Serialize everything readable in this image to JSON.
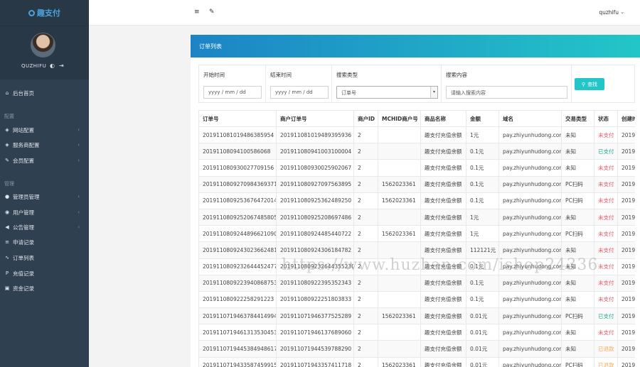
{
  "brand": {
    "title": "趣支付"
  },
  "profile": {
    "username": "QUZHIFU"
  },
  "sidebar": {
    "home": "后台首页",
    "section_config": "配置",
    "config_items": [
      "网站配置",
      "服务商配置",
      "会员配置"
    ],
    "section_manage": "管理",
    "manage_items": [
      "管理员管理",
      "用户管理",
      "公告管理",
      "申请记录",
      "订单列表",
      "充值记录",
      "资金记录"
    ]
  },
  "topbar": {
    "user": "quzhifu"
  },
  "card": {
    "title": "订单列表"
  },
  "search": {
    "start_label": "开始时间",
    "start_placeholder": "yyyy / mm / dd",
    "end_label": "结束时间",
    "end_placeholder": "yyyy / mm / dd",
    "type_label": "搜索类型",
    "type_value": "订单号",
    "content_label": "搜索内容",
    "content_placeholder": "请输入搜索内容",
    "button": "查找"
  },
  "table": {
    "headers": [
      "订单号",
      "商户订单号",
      "商户ID",
      "MCHID商户号",
      "商品名称",
      "金额",
      "域名",
      "交易类型",
      "状态",
      "创建时"
    ],
    "rows": [
      [
        "20191108101948638595​4",
        "2019110810194893​95936",
        "2",
        "",
        "趣支付充值余额",
        "1元",
        "pay.zhiyunhudong.com",
        "未知",
        "未支付",
        "2019-"
      ],
      [
        "20191108094100586068",
        "20191108094100310000​4",
        "2",
        "",
        "趣支付充值余额",
        "0.1元",
        "pay.zhiyunhudong.com",
        "未知",
        "已支付",
        "2019-"
      ],
      [
        "20191108093002770915​6",
        "20191108093002590206​7",
        "2",
        "",
        "趣支付充值余额",
        "0.1元",
        "pay.zhiyunhudong.com",
        "未知",
        "未支付",
        "2019"
      ],
      [
        "20191108092709843693​71",
        "20191108092709756389​5",
        "2",
        "1562023361",
        "趣支付充值余额",
        "0.1元",
        "pay.zhiyunhudong.com",
        "PC扫码",
        "未支付",
        "2019-"
      ],
      [
        "20191108092536764720​14",
        "20191108092536248925​0",
        "2",
        "1562023361",
        "趣支付充值余额",
        "0.1元",
        "pay.zhiyunhudong.com",
        "PC扫码",
        "未支付",
        "2019-"
      ],
      [
        "20191108092520674858​05",
        "20191108092520869748​6",
        "2",
        "",
        "趣支付充值余额",
        "1元",
        "pay.zhiyunhudong.com",
        "未知",
        "未支付",
        "2019-"
      ],
      [
        "20191108092448966210​90",
        "20191108092448544072​2",
        "2",
        "1562023361",
        "趣支付充值余额",
        "1元",
        "pay.zhiyunhudong.com",
        "PC扫码",
        "未支付",
        "2019-"
      ],
      [
        "20191108092430236624​81",
        "20191108092430618478​2",
        "2",
        "",
        "趣支付充值余额",
        "112121元",
        "pay.zhiyunhudong.com",
        "未知",
        "未支付",
        "2019-"
      ],
      [
        "20191108092326444524​77",
        "20191108092326443552​30",
        "2",
        "",
        "趣支付充值余额",
        "0.1元",
        "pay.zhiyunhudong.com",
        "未知",
        "未支付",
        "2019-"
      ],
      [
        "20191108092239408687​53",
        "20191108092239535234​3",
        "2",
        "",
        "趣支付充值余额",
        "0.1元",
        "pay.zhiyunhudong.com",
        "未知",
        "未支付",
        "2019-"
      ],
      [
        "20191108092225829122​3",
        "20191108092225180383​3",
        "2",
        "",
        "趣支付充值余额",
        "0.1元",
        "pay.zhiyunhudong.com",
        "未知",
        "未支付",
        "2019-"
      ],
      [
        "20191107194637844149​94",
        "20191107194637752528​9",
        "2",
        "1562023361",
        "趣支付充值余额",
        "0.01元",
        "pay.zhiyunhudong.com",
        "PC扫码",
        "已支付",
        "2019-"
      ],
      [
        "20191107194613135304​53",
        "20191107194613768906​0",
        "2",
        "",
        "趣支付充值余额",
        "0.01元",
        "pay.zhiyunhudong.com",
        "未知",
        "未支付",
        "2019-"
      ],
      [
        "20191107194453849486​17",
        "20191107194453978829​0",
        "2",
        "",
        "趣支付充值余额",
        "0.01元",
        "pay.zhiyunhudong.com",
        "未知",
        "已退款",
        "2019-"
      ],
      [
        "20191107194335874599​15",
        "20191107194335741171​8",
        "2",
        "1562023361",
        "趣支付充值余额",
        "0.01元",
        "pay.zhiyunhudong.com",
        "PC扫码",
        "已退款",
        "2019-"
      ]
    ]
  },
  "watermark": "https://www.huzhan.com/ishop24336",
  "colors": {
    "sidebar": "#2f4050",
    "accent": "#23c6c8",
    "header_start": "#1c84c6",
    "unpaid": "#ed5565",
    "paid": "#1ab394",
    "refunded": "#f8ac59"
  }
}
